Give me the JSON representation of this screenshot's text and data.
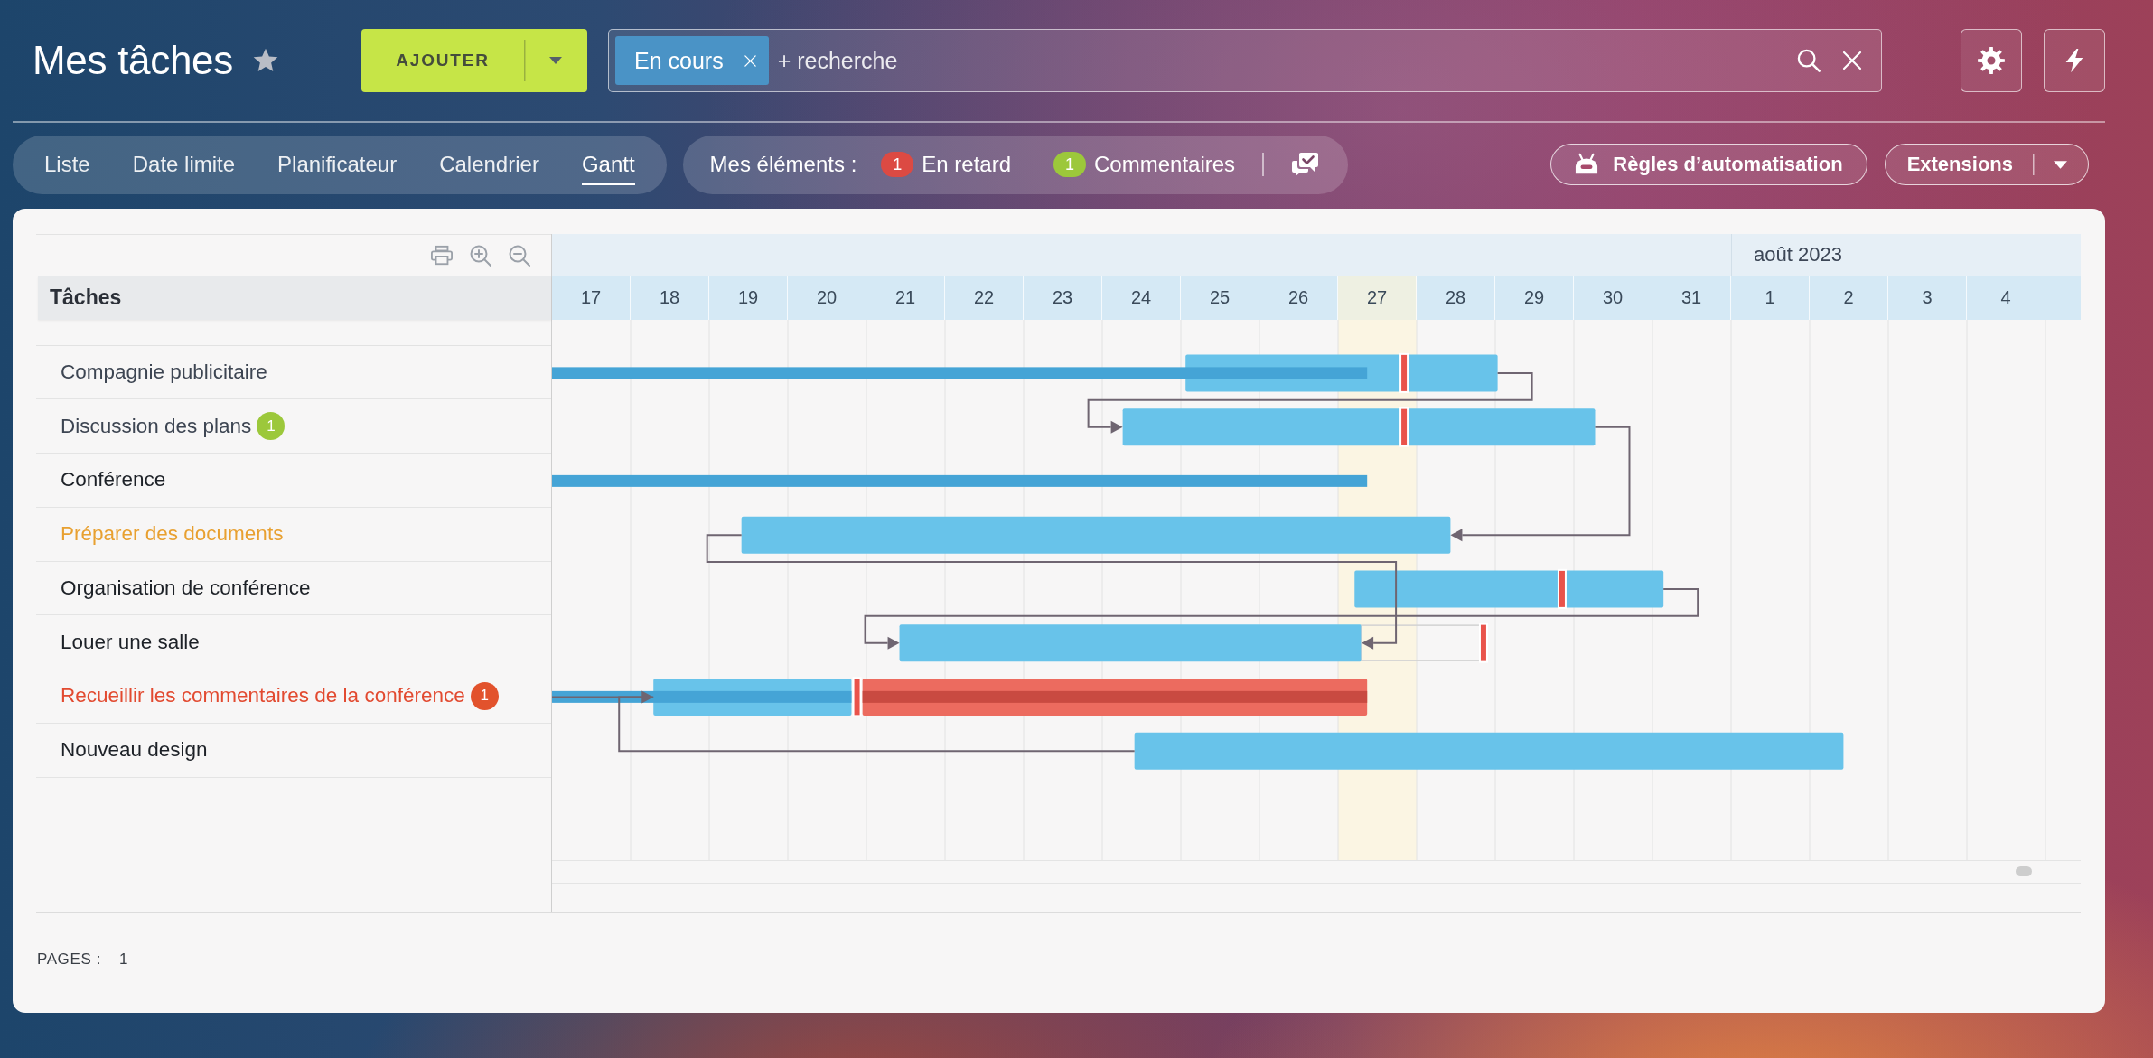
{
  "header": {
    "title": "Mes tâches",
    "starred": false,
    "add_button": {
      "label": "AJOUTER"
    },
    "search": {
      "chips": [
        {
          "label": "En cours"
        }
      ],
      "placeholder": "+ recherche"
    }
  },
  "view_tabs": [
    {
      "label": "Liste",
      "selected": false
    },
    {
      "label": "Date limite",
      "selected": false
    },
    {
      "label": "Planificateur",
      "selected": false
    },
    {
      "label": "Calendrier",
      "selected": false
    },
    {
      "label": "Gantt",
      "selected": true
    }
  ],
  "my_items": {
    "label": "Mes éléments :",
    "counters": [
      {
        "count": "1",
        "label": "En retard",
        "color": "#dc4a43"
      },
      {
        "count": "1",
        "label": "Commentaires",
        "color": "#9cc83b"
      }
    ]
  },
  "automation_button": {
    "label": "Règles d’automatisation"
  },
  "extensions_button": {
    "label": "Extensions"
  },
  "gantt": {
    "column_header": "Tâches",
    "tasks": [
      {
        "title": "Compagnie publicitaire",
        "color": "#3d4552"
      },
      {
        "title": "Discussion des plans",
        "color": "#3d4552",
        "badge": {
          "text": "1",
          "color": "#9cc83b"
        }
      },
      {
        "title": "Conférence",
        "color": "#1d2127"
      },
      {
        "title": "Préparer des documents",
        "color": "#e8a030"
      },
      {
        "title": "Organisation de conférence",
        "color": "#1d2127"
      },
      {
        "title": "Louer une salle",
        "color": "#1d2127"
      },
      {
        "title": "Recueillir les commentaires de la conférence",
        "color": "#e24a30",
        "badge": {
          "text": "1",
          "color": "#e2522c"
        }
      },
      {
        "title": "Nouveau design",
        "color": "#1d2127"
      }
    ],
    "timeline": {
      "months": [
        {
          "days": [
            {
              "label": "17",
              "today": false
            },
            {
              "label": "18",
              "today": false
            },
            {
              "label": "19",
              "today": false
            },
            {
              "label": "20",
              "today": false
            },
            {
              "label": "21",
              "today": false
            },
            {
              "label": "22",
              "today": false
            },
            {
              "label": "23",
              "today": false
            },
            {
              "label": "24",
              "today": false
            },
            {
              "label": "25",
              "today": false
            },
            {
              "label": "26",
              "today": false
            },
            {
              "label": "27",
              "today": true
            },
            {
              "label": "28",
              "today": false
            },
            {
              "label": "29",
              "today": false
            },
            {
              "label": "30",
              "today": false
            },
            {
              "label": "31",
              "today": false
            }
          ]
        },
        {
          "label": "août 2023",
          "days": [
            {
              "label": "1",
              "today": false
            },
            {
              "label": "2",
              "today": false
            },
            {
              "label": "3",
              "today": false
            },
            {
              "label": "4",
              "today": false
            }
          ]
        }
      ]
    }
  },
  "pagination": {
    "label": "PAGES :",
    "page": "1"
  }
}
